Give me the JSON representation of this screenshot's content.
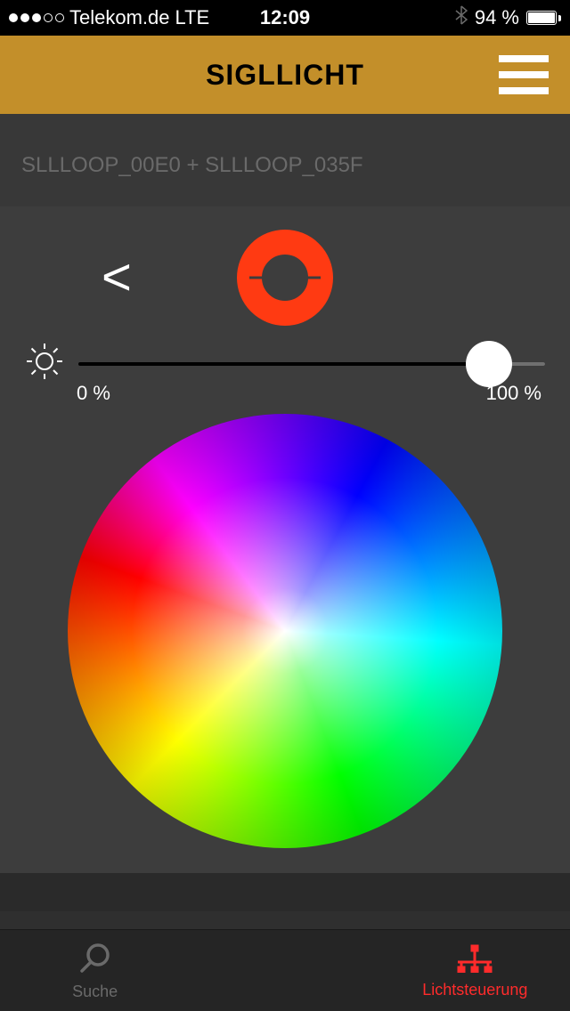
{
  "status_bar": {
    "carrier": "Telekom.de",
    "network_type": "LTE",
    "time": "12:09",
    "battery_percent": "94 %"
  },
  "header": {
    "title": "SIGLLICHT"
  },
  "device": {
    "names": "SLLLOOP_00E0 + SLLLOOP_035F"
  },
  "brightness": {
    "min_label": "0 %",
    "max_label": "100 %",
    "value_percent": 88
  },
  "selected_color": "#ff3a12",
  "tabs": {
    "search": "Suche",
    "light_control": "Lichtsteuerung"
  }
}
